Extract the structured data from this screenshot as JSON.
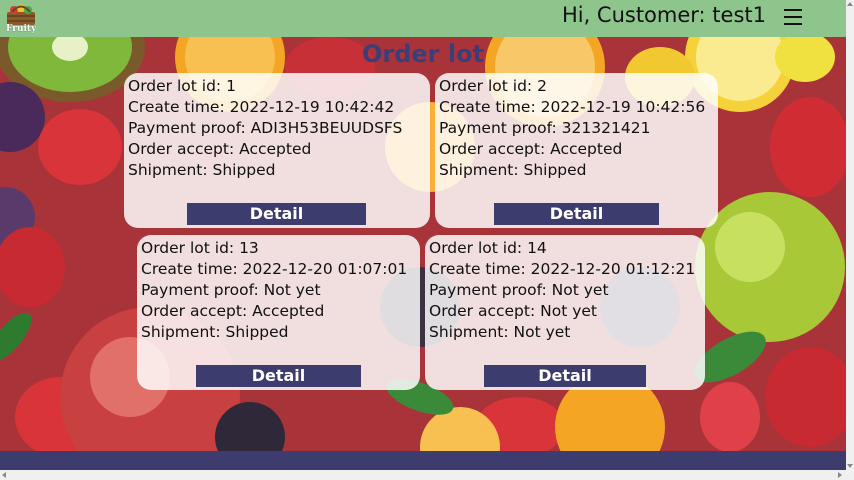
{
  "header": {
    "logo_text": "Fruity",
    "greeting": "Hi, Customer: test1",
    "menu_icon": "hamburger-menu-icon"
  },
  "page": {
    "title": "Order lot"
  },
  "orders": [
    {
      "id_line": "Order lot id: 1",
      "create_line": "Create time: 2022-12-19 10:42:42",
      "payment_line": "Payment proof: ADI3H53BEUUDSFS",
      "accept_line": "Order accept: Accepted",
      "shipment_line": "Shipment: Shipped",
      "button_label": "Detail"
    },
    {
      "id_line": "Order lot id: 2",
      "create_line": "Create time: 2022-12-19 10:42:56",
      "payment_line": "Payment proof: 321321421",
      "accept_line": "Order accept: Accepted",
      "shipment_line": "Shipment: Shipped",
      "button_label": "Detail"
    },
    {
      "id_line": "Order lot id: 13",
      "create_line": "Create time: 2022-12-20 01:07:01",
      "payment_line": "Payment proof: Not yet",
      "accept_line": "Order accept: Accepted",
      "shipment_line": "Shipment: Shipped",
      "button_label": "Detail"
    },
    {
      "id_line": "Order lot id: 14",
      "create_line": "Create time: 2022-12-20 01:12:21",
      "payment_line": "Payment proof: Not yet",
      "accept_line": "Order accept: Not yet",
      "shipment_line": "Shipment: Not yet",
      "button_label": "Detail"
    }
  ],
  "colors": {
    "header_bg": "#8dc58d",
    "accent": "#3c3c6e",
    "title": "#3a3f7a"
  }
}
